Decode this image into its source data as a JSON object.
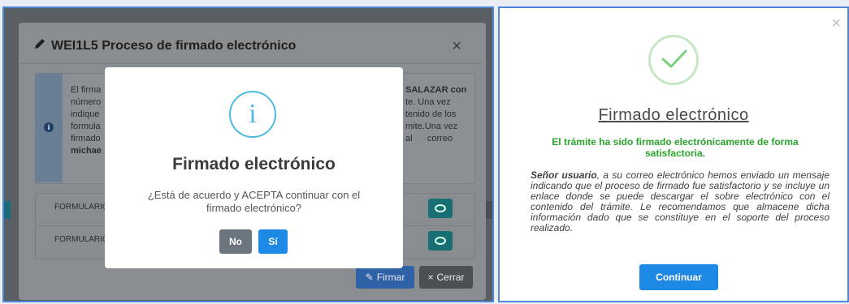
{
  "left": {
    "background_dialog": {
      "title": "WEI1L5 Proceso de firmado electrónico",
      "close_glyph": "×",
      "info_lines": [
        {
          "left": "El firma",
          "right": "SALAZAR con"
        },
        {
          "left": "número",
          "right": "te. Una vez"
        },
        {
          "left": "indique",
          "right": "tenido de los"
        },
        {
          "left": "formula",
          "right": "mite.Una vez"
        },
        {
          "left": "firmado",
          "right": "al      correo"
        },
        {
          "left": "michae",
          "right": ""
        }
      ],
      "forms": [
        "FORMULARIO",
        "FORMULARIO"
      ],
      "firmar_label": "Firmar",
      "cerrar_label": "Cerrar"
    },
    "confirm_modal": {
      "icon": "i",
      "title": "Firmado electrónico",
      "message": "¿Está de acuerdo y ACEPTA continuar con el firmado electrónico?",
      "no_label": "No",
      "si_label": "Sí"
    }
  },
  "right": {
    "close_glyph": "×",
    "title": "Firmado electrónico",
    "success_message": "El trámite ha sido firmado electrónicamente de forma satisfactoria.",
    "body_lead": "Señor usuario",
    "body_text": ", a su correo electrónico hemos enviado un mensaje indicando que el proceso de firmado fue satisfactorio y se incluye un enlace donde se puede descargar el sobre electrónico con el contenido del trámite. Le recomendamos que almacene dicha información dado que se constituye en el soporte del proceso realizado.",
    "continue_label": "Continuar"
  },
  "colors": {
    "primary_button": "#1e88e5",
    "success_text": "#29a52c",
    "info_icon": "#4db8e0",
    "success_check": "#7ccf7c"
  },
  "icons": [
    "pencil-icon",
    "close-icon",
    "info-icon",
    "eye-icon",
    "check-icon"
  ]
}
